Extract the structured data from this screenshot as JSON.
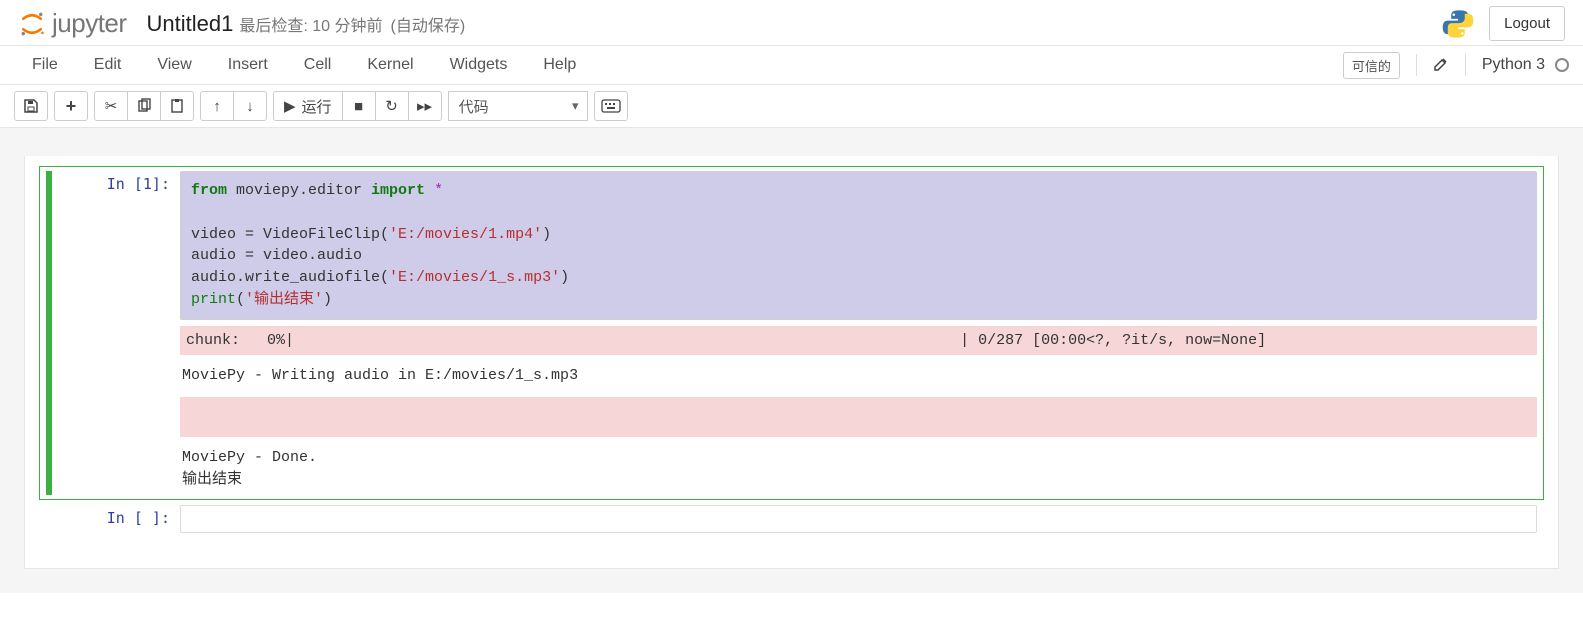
{
  "header": {
    "logo_text": "jupyter",
    "title": "Untitled1",
    "checkpoint": "最后检查: 10 分钟前",
    "autosave": "(自动保存)",
    "logout": "Logout"
  },
  "menubar": {
    "items": [
      "File",
      "Edit",
      "View",
      "Insert",
      "Cell",
      "Kernel",
      "Widgets",
      "Help"
    ],
    "trusted": "可信的",
    "kernel": "Python 3"
  },
  "toolbar": {
    "run_label": "运行",
    "cell_type": "代码"
  },
  "cells": [
    {
      "prompt": "In [1]:",
      "code_tokens": [
        {
          "t": "from ",
          "c": "tok-key"
        },
        {
          "t": "moviepy.editor ",
          "c": ""
        },
        {
          "t": "import ",
          "c": "tok-imp"
        },
        {
          "t": "*",
          "c": "tok-star"
        },
        {
          "t": "\n\n",
          "c": ""
        },
        {
          "t": "video = VideoFileClip(",
          "c": ""
        },
        {
          "t": "'E:/movies/1.mp4'",
          "c": "tok-str"
        },
        {
          "t": ")\n",
          "c": ""
        },
        {
          "t": "audio = video.audio\n",
          "c": ""
        },
        {
          "t": "audio.write_audiofile(",
          "c": ""
        },
        {
          "t": "'E:/movies/1_s.mp3'",
          "c": "tok-str"
        },
        {
          "t": ")\n",
          "c": ""
        },
        {
          "t": "print",
          "c": "tok-print"
        },
        {
          "t": "(",
          "c": ""
        },
        {
          "t": "'输出结束'",
          "c": "tok-str"
        },
        {
          "t": ")",
          "c": ""
        }
      ],
      "outputs": [
        {
          "kind": "err",
          "text": "chunk:   0%|                                                                          | 0/287 [00:00<?, ?it/s, now=None]"
        },
        {
          "kind": "txt",
          "text": "MoviePy - Writing audio in E:/movies/1_s.mp3"
        },
        {
          "kind": "bar"
        },
        {
          "kind": "txt",
          "text": "MoviePy - Done.\n输出结束"
        }
      ]
    },
    {
      "prompt": "In [ ]:",
      "empty": true
    }
  ]
}
